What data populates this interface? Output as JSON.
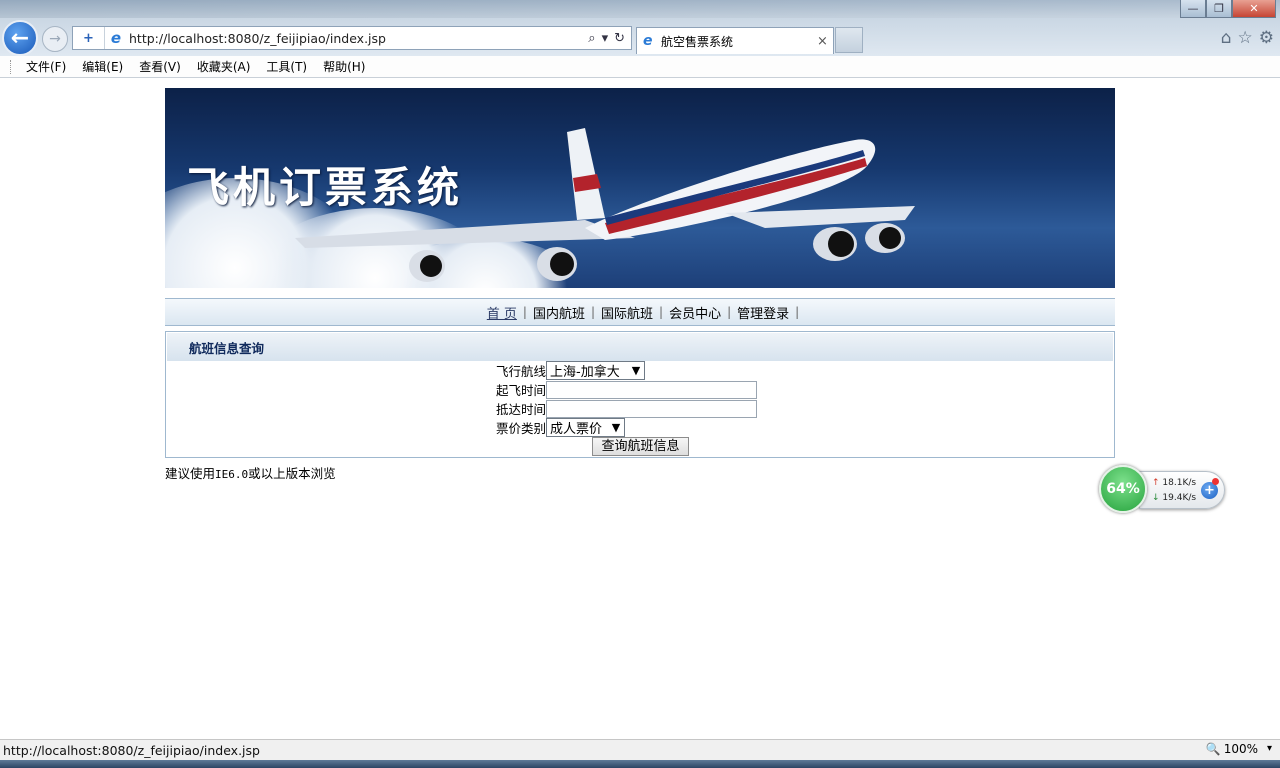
{
  "browser": {
    "window_buttons": {
      "minimize": "—",
      "maximize": "❐",
      "close": "✕"
    },
    "back_icon": "←",
    "forward_icon": "→",
    "compat_icon": "+",
    "ie_icon": "e",
    "url": "http://localhost:8080/z_feijipiao/index.jsp",
    "search_icon": "⌕",
    "dropdown_icon": "▾",
    "refresh_icon": "↻",
    "tab": {
      "title": "航空售票系统",
      "close": "×"
    },
    "home_icon": "⌂",
    "favorites_icon": "☆",
    "tools_icon": "⚙"
  },
  "menubar": {
    "items": [
      "文件(F)",
      "编辑(E)",
      "查看(V)",
      "收藏夹(A)",
      "工具(T)",
      "帮助(H)"
    ]
  },
  "banner": {
    "title": "飞机订票系统"
  },
  "nav": {
    "links": [
      "首 页",
      "国内航班",
      "国际航班",
      "会员中心",
      "管理登录"
    ],
    "separator": "|"
  },
  "search_panel": {
    "title": "航班信息查询",
    "route_label": "飞行航线",
    "route_value": "上海-加拿大",
    "depart_label": "起飞时间",
    "depart_value": "",
    "arrive_label": "抵达时间",
    "arrive_value": "",
    "fare_label": "票价类别",
    "fare_value": "成人票价",
    "submit_label": "查询航班信息"
  },
  "footer_note": {
    "prefix": "建议使用",
    "version": "IE6.0",
    "suffix": "或以上版本浏览"
  },
  "net_widget": {
    "percent": "64%",
    "up_icon": "↑",
    "up_speed": "18.1K/s",
    "down_icon": "↓",
    "down_speed": "19.4K/s",
    "plus_icon": "+"
  },
  "statusbar": {
    "url": "http://localhost:8080/z_feijipiao/index.jsp",
    "zoom_icon": "🔍",
    "zoom": "100%",
    "zoom_dropdown": "▾"
  }
}
